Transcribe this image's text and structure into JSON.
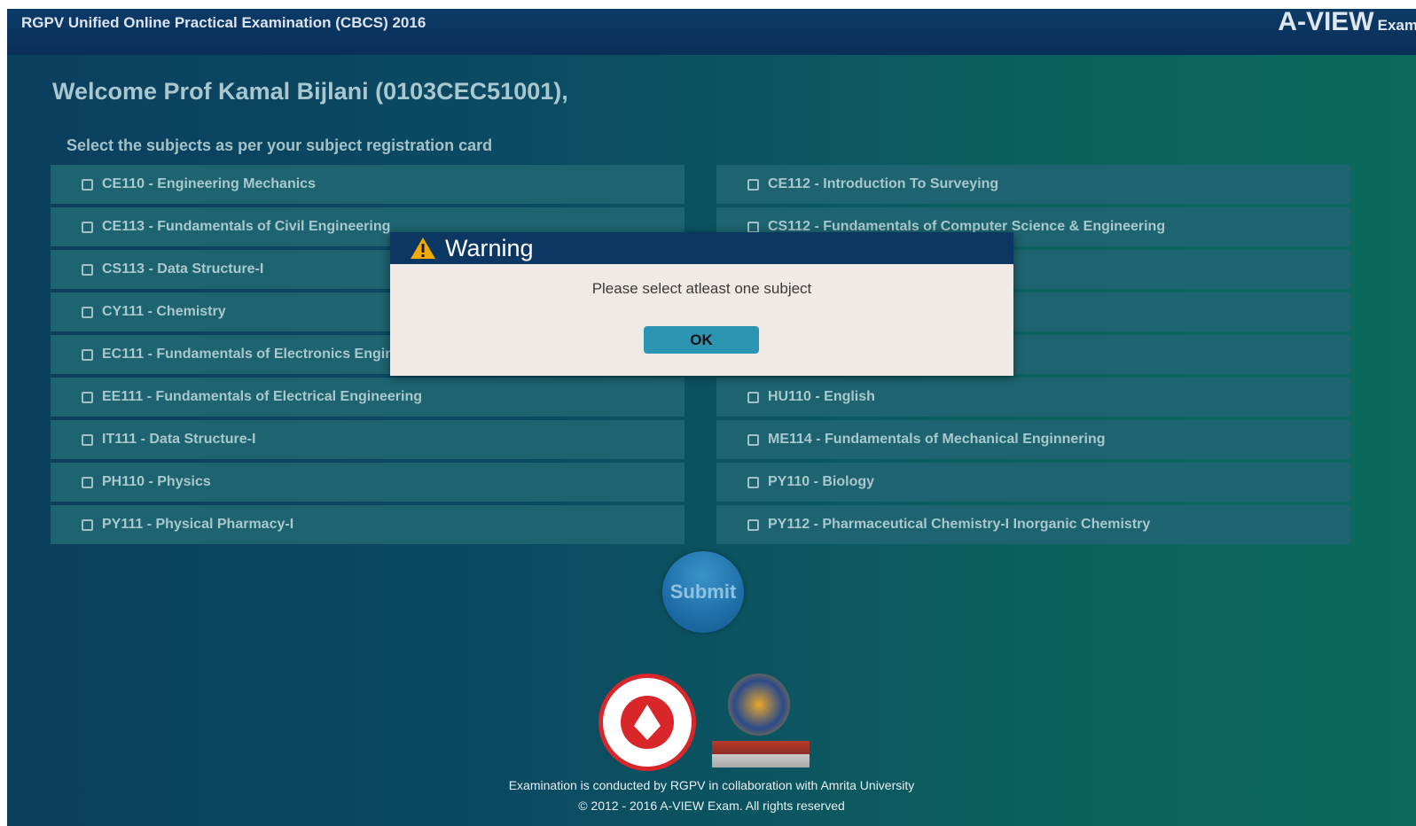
{
  "header": {
    "title": "RGPV Unified Online Practical Examination (CBCS) 2016",
    "brand_main": "A-VIEW",
    "brand_sub": "Exam"
  },
  "welcome": "Welcome Prof Kamal Bijlani (0103CEC51001),",
  "instruction": "Select the subjects as per your subject registration card",
  "subjects_left": [
    "CE110 - Engineering Mechanics",
    "CE113 - Fundamentals of Civil Engineering",
    "CS113 - Data Structure-I",
    "CY111 - Chemistry",
    "EC111 - Fundamentals of Electronics Engineering",
    "EE111 - Fundamentals of Electrical Engineering",
    "IT111 - Data Structure-I",
    "PH110 - Physics",
    "PY111 - Physical Pharmacy-I"
  ],
  "subjects_right": [
    "CE112 - Introduction To Surveying",
    "CS112 - Fundamentals of Computer Science & Engineering",
    "",
    "",
    "",
    "HU110 - English",
    "ME114 - Fundamentals of Mechanical Enginnering",
    "PY110 - Biology",
    "PY112 - Pharmaceutical Chemistry-I Inorganic Chemistry"
  ],
  "submit_label": "Submit",
  "footer": {
    "line1": "Examination is conducted by RGPV in collaboration with Amrita University",
    "line2": "© 2012 - 2016 A-VIEW Exam. All rights reserved"
  },
  "dialog": {
    "title": "Warning",
    "message": "Please select atleast one subject",
    "ok_label": "OK"
  },
  "colors": {
    "header_bg": "#0b3a66",
    "row_bg": "#1d6470",
    "dialog_header": "#0c3763",
    "ok_button": "#2c95b1",
    "warning_icon": "#f2a900"
  },
  "icons": [
    "checkbox-icon",
    "warning-icon"
  ]
}
